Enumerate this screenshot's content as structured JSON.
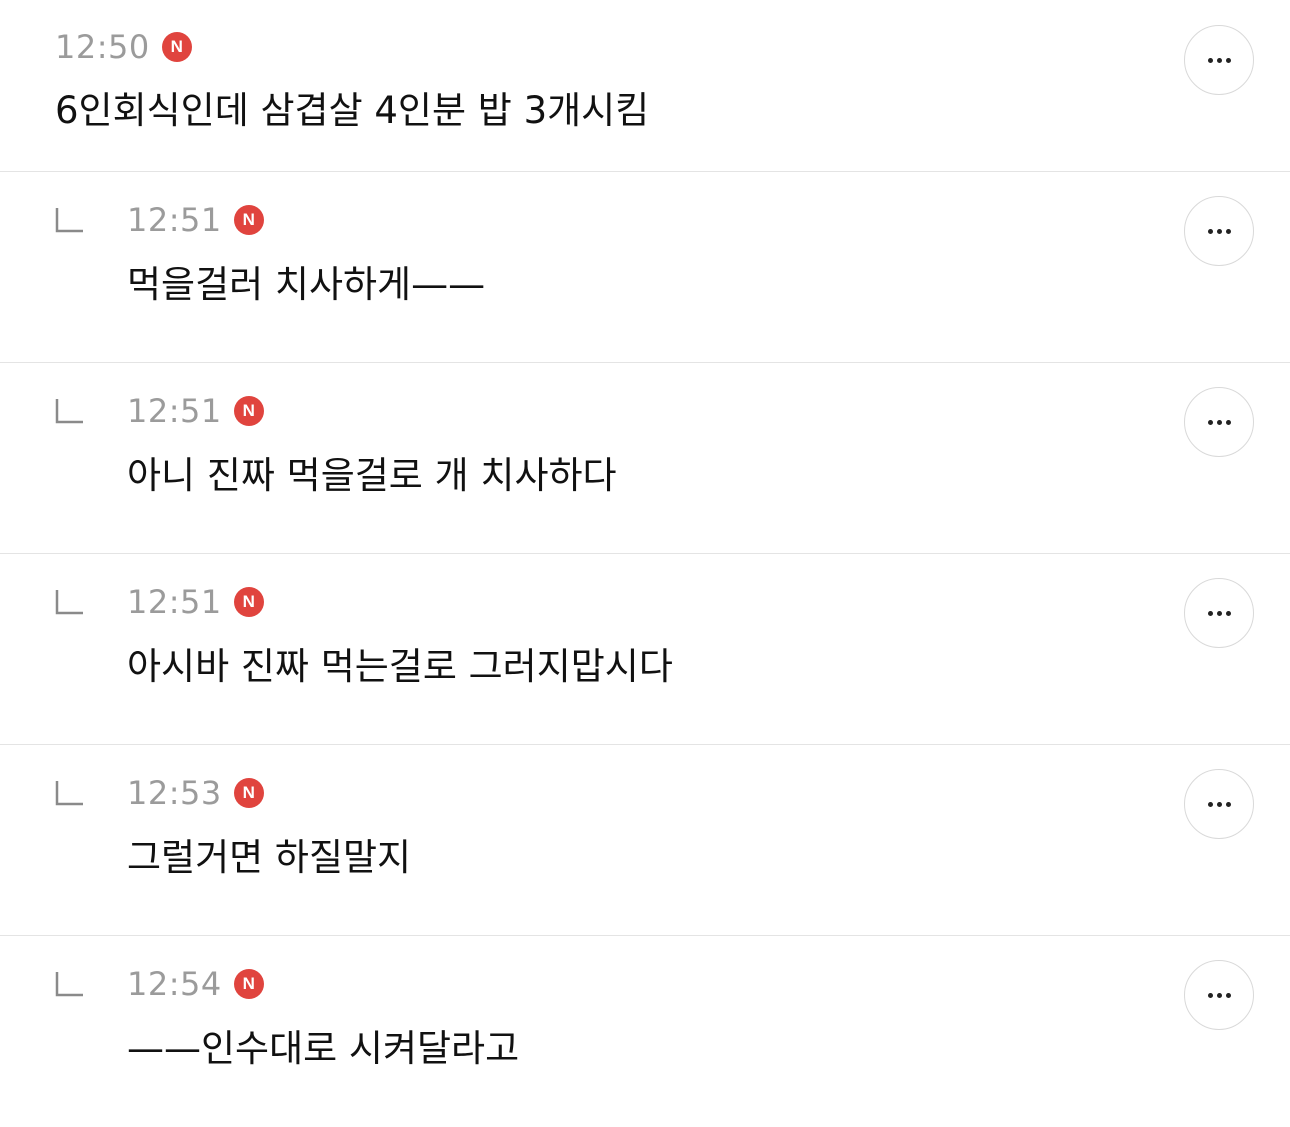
{
  "theme": {
    "badge_color": "#e0443e",
    "time_color": "#9b9b9b",
    "divider_color": "#e4e4e4"
  },
  "comments": [
    {
      "time": "12:50",
      "badge": "N",
      "text": "6인회식인데 삼겹살 4인분 밥 3개시킴",
      "is_reply": false,
      "more_icon": "ellipsis-icon"
    },
    {
      "time": "12:51",
      "badge": "N",
      "text": "먹을걸러 치사하게——",
      "is_reply": true,
      "more_icon": "ellipsis-icon"
    },
    {
      "time": "12:51",
      "badge": "N",
      "text": "아니 진짜 먹을걸로 개 치사하다",
      "is_reply": true,
      "more_icon": "ellipsis-icon"
    },
    {
      "time": "12:51",
      "badge": "N",
      "text": "아시바 진짜 먹는걸로 그러지맙시다",
      "is_reply": true,
      "more_icon": "ellipsis-icon"
    },
    {
      "time": "12:53",
      "badge": "N",
      "text": "그럴거면 하질말지",
      "is_reply": true,
      "more_icon": "ellipsis-icon"
    },
    {
      "time": "12:54",
      "badge": "N",
      "text": "——인수대로 시켜달라고",
      "is_reply": true,
      "more_icon": "ellipsis-icon"
    }
  ]
}
